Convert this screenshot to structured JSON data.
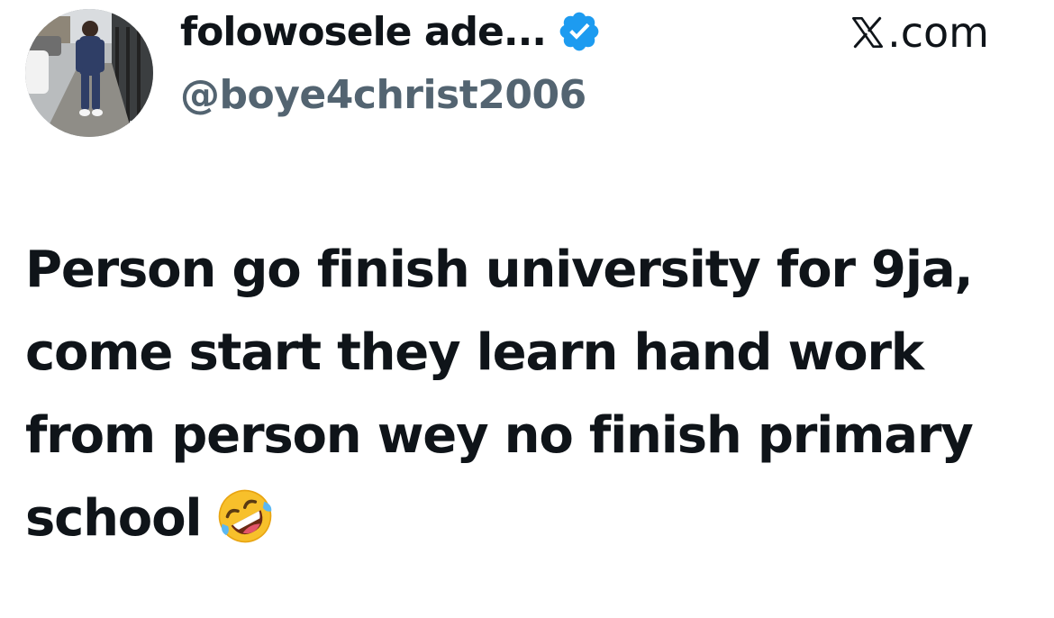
{
  "tweet": {
    "author": {
      "display_name": "folowosele ade...",
      "handle": "@boye4christ2006",
      "verified": true,
      "avatar": "person-standing-on-sidewalk-photo"
    },
    "source": {
      "logo_icon": "x-logo-icon",
      "domain": ".com"
    },
    "text_lines": [
      "Person go finish university for 9ja,",
      "come start they learn hand work",
      "from person wey no finish primary",
      "school"
    ],
    "emoji": "rolling-on-the-floor-laughing-icon"
  },
  "colors": {
    "text_primary": "#0f1419",
    "text_secondary": "#536471",
    "verified_blue": "#1d9bf0",
    "background": "#ffffff"
  }
}
